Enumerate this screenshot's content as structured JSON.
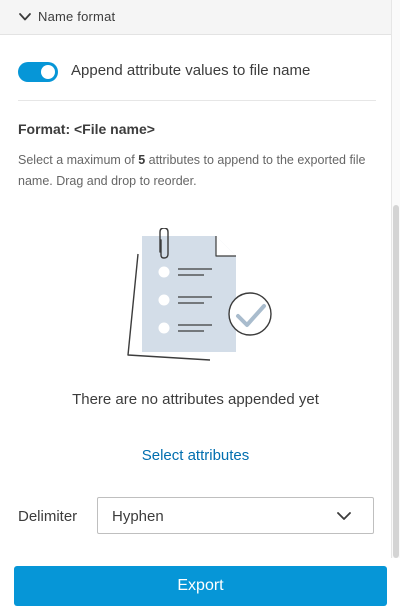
{
  "section": {
    "title": "Name format",
    "chevron_icon": "chevron-down-icon"
  },
  "toggle": {
    "label": "Append attribute values to file name",
    "state": "on",
    "color": "#0696d7"
  },
  "format": {
    "title": "Format: <File name>"
  },
  "help": {
    "prefix": "Select a maximum of ",
    "max_count": "5",
    "suffix": " attributes to append to the exported file name. Drag and drop to reorder."
  },
  "illustration": {
    "icon": "document-checklist-icon"
  },
  "empty_state": {
    "text": "There are no attributes appended yet"
  },
  "select_link": {
    "label": "Select attributes"
  },
  "delimiter": {
    "label": "Delimiter",
    "value": "Hyphen"
  },
  "footer": {
    "export_label": "Export"
  },
  "colors": {
    "accent": "#0696d7",
    "link": "#006eaf"
  }
}
